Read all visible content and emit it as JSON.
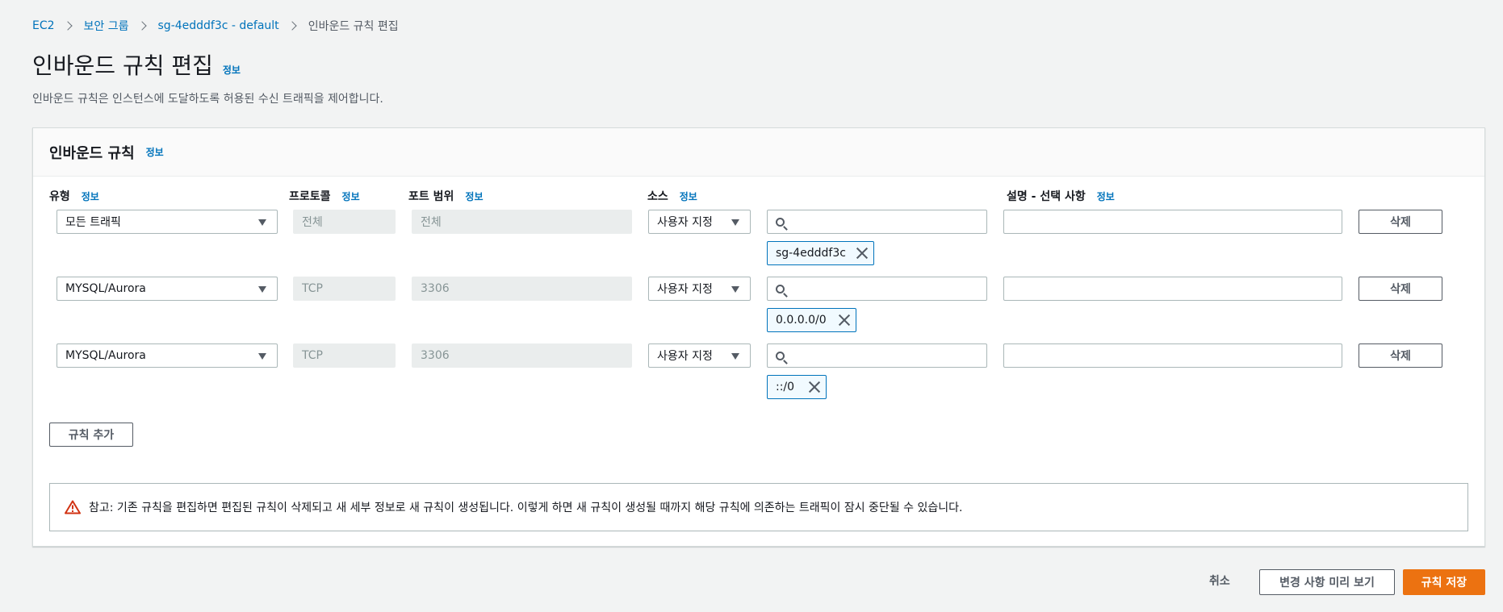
{
  "breadcrumb": [
    "EC2",
    "보안 그룹",
    "sg-4edddf3c - default",
    "인바운드 규칙 편집"
  ],
  "page": {
    "title": "인바운드 규칙 편집",
    "info": "정보",
    "description": "인바운드 규칙은 인스턴스에 도달하도록 허용된 수신 트래픽을 제어합니다."
  },
  "panel": {
    "title": "인바운드 규칙",
    "info": "정보",
    "columns": {
      "type": "유형",
      "protocol": "프로토콜",
      "port_range": "포트 범위",
      "source": "소스",
      "description": "설명 - 선택 사항",
      "info": "정보"
    },
    "rules": [
      {
        "type": "모든 트래픽",
        "protocol": "전체",
        "port_range": "전체",
        "source_mode": "사용자 지정",
        "source_search": "",
        "token": "sg-4edddf3c",
        "description": "",
        "delete_label": "삭제"
      },
      {
        "type": "MYSQL/Aurora",
        "protocol": "TCP",
        "port_range": "3306",
        "source_mode": "사용자 지정",
        "source_search": "",
        "token": "0.0.0.0/0",
        "description": "",
        "delete_label": "삭제"
      },
      {
        "type": "MYSQL/Aurora",
        "protocol": "TCP",
        "port_range": "3306",
        "source_mode": "사용자 지정",
        "source_search": "",
        "token": "::/0",
        "description": "",
        "delete_label": "삭제"
      }
    ],
    "add_rule_label": "규칙 추가",
    "notice": "참고: 기존 규칙을 편집하면 편집된 규칙이 삭제되고 새 세부 정보로 새 규칙이 생성됩니다. 이렇게 하면 새 규칙이 생성될 때까지 해당 규칙에 의존하는 트래픽이 잠시 중단될 수 있습니다."
  },
  "footer": {
    "cancel_label": "취소",
    "preview_label": "변경 사항 미리 보기",
    "save_label": "규칙 저장"
  },
  "colors": {
    "accent": "#ec7211",
    "link": "#0073bb",
    "warning": "#d13212"
  },
  "icons": [
    "chevron-right-icon",
    "caret-down-icon",
    "search-icon",
    "remove-icon",
    "warning-icon"
  ]
}
